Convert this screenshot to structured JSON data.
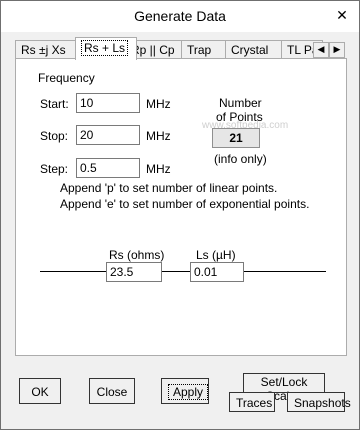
{
  "window": {
    "title": "Generate Data",
    "close_glyph": "✕"
  },
  "tabs": [
    {
      "label": "Rs ±j Xs"
    },
    {
      "label": "Rs + Ls"
    },
    {
      "label": "Rp || Cp"
    },
    {
      "label": "Trap"
    },
    {
      "label": "Crystal"
    },
    {
      "label": "TL Pa"
    }
  ],
  "tab_scroll": {
    "prev": "◀",
    "next": "▶"
  },
  "watermark": "www.softpedia.com",
  "frequency": {
    "heading": "Frequency",
    "start_label": "Start:",
    "start_value": "10",
    "stop_label": "Stop:",
    "stop_value": "20",
    "step_label": "Step:",
    "step_value": "0.5",
    "unit": "MHz"
  },
  "points": {
    "label_line1": "Number",
    "label_line2": "of Points",
    "value": "21",
    "note": "(info only)"
  },
  "hints": {
    "linear": "Append 'p' to set number of linear points.",
    "exponential": "Append 'e' to set number of exponential points."
  },
  "circuit": {
    "rs_label": "Rs (ohms)",
    "rs_value": "23.5",
    "ls_label": "Ls (µH)",
    "ls_value": "0.01"
  },
  "buttons": {
    "ok": "OK",
    "close": "Close",
    "apply": "Apply",
    "set_lock_scales": "Set/Lock Scales",
    "traces": "Traces",
    "snapshots": "Snapshots"
  }
}
